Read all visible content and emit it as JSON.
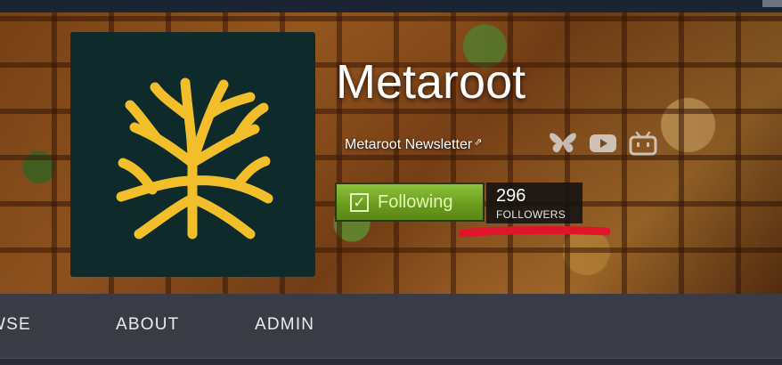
{
  "group": {
    "name": "Metaroot",
    "newsletter_label": "Metaroot Newsletter",
    "newsletter_ext_glyph": "⇗"
  },
  "follow": {
    "button_label": "Following",
    "check_glyph": "✓",
    "followers_count": "296",
    "followers_caption": "FOLLOWERS"
  },
  "social": [
    "bluesky-icon",
    "youtube-icon",
    "bilibili-icon"
  ],
  "nav": {
    "items": [
      {
        "label": "WSE"
      },
      {
        "label": "ABOUT"
      },
      {
        "label": "ADMIN"
      }
    ]
  },
  "colors": {
    "logo_bg": "#0e2a2b",
    "logo_fg": "#f2bf2a",
    "follow_green": "#6a9a1c",
    "nav_bg": "#393c44",
    "annotation_red": "#e0152b"
  }
}
